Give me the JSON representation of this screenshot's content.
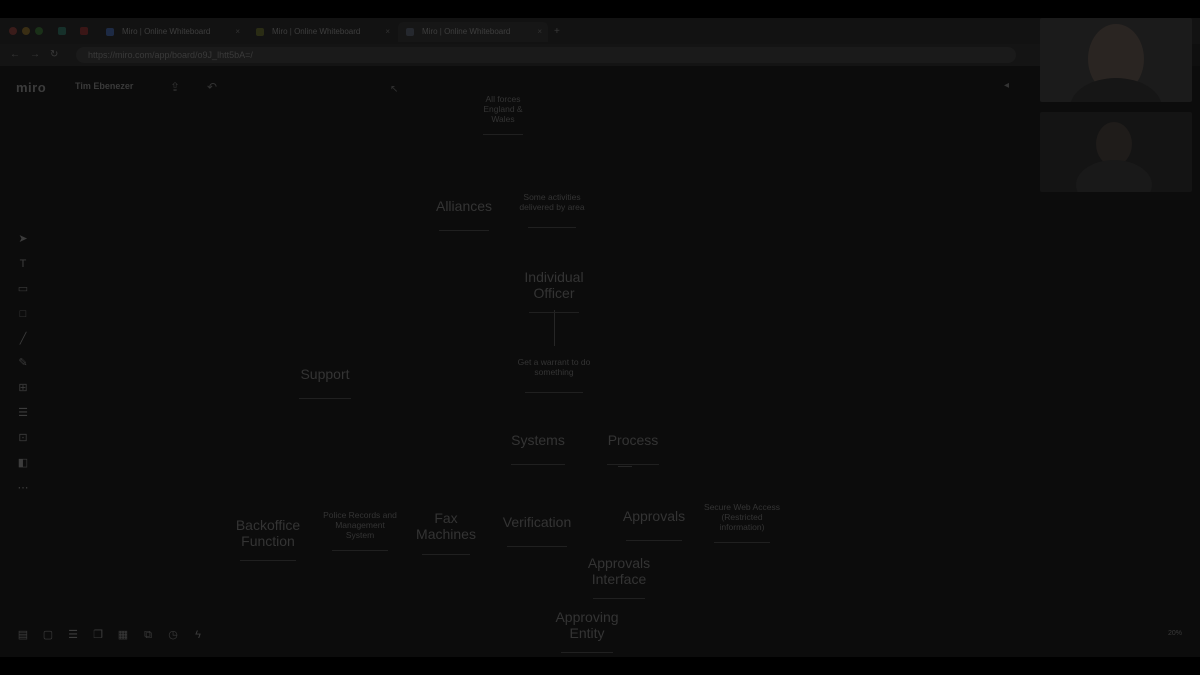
{
  "browser": {
    "tabs": [
      {
        "label": "Miro | Online Whiteboard",
        "fav_color": "#1d2a44"
      },
      {
        "label": "Miro | Online Whiteboard",
        "fav_color": "#2a2c14"
      },
      {
        "label": "Miro | Online Whiteboard",
        "fav_color": "#25282e"
      }
    ],
    "url": "https://miro.com/app/board/o9J_lhtt5bA=/"
  },
  "app": {
    "logo": "miro",
    "board_name": "Tim Ebenezer",
    "zoom": "20%"
  },
  "stickies": [
    {
      "text": "All forces England & Wales",
      "size": "small"
    },
    {
      "text": "Alliances",
      "size": "big"
    },
    {
      "text": "Some activities delivered by area",
      "size": "small"
    },
    {
      "text": "Individual Officer",
      "size": "big"
    },
    {
      "text": "Get a warrant to do something",
      "size": "small"
    },
    {
      "text": "Support",
      "size": "big"
    },
    {
      "text": "Systems",
      "size": "big"
    },
    {
      "text": "Process",
      "size": "big"
    },
    {
      "text": "Backoffice Function",
      "size": "big"
    },
    {
      "text": "Police Records and Management System",
      "size": "small"
    },
    {
      "text": "Fax Machines",
      "size": "big"
    },
    {
      "text": "Verification",
      "size": "big"
    },
    {
      "text": "Approvals",
      "size": "big"
    },
    {
      "text": "Secure Web Access (Restricted information)",
      "size": "small"
    },
    {
      "text": "Approvals Interface",
      "size": "big"
    },
    {
      "text": "Approving Entity",
      "size": "big"
    }
  ],
  "icons": {
    "toolbar": [
      "select-icon",
      "text-icon",
      "sticky-note-icon",
      "shape-icon",
      "line-icon",
      "pen-icon",
      "frame-icon",
      "comment-icon",
      "template-icon",
      "kanban-icon",
      "more-icon"
    ],
    "bottombar": [
      "frames-icon",
      "comments-icon",
      "chat-icon",
      "cards-icon",
      "apps-icon",
      "screen-share-icon",
      "timer-icon",
      "lightning-icon"
    ]
  }
}
